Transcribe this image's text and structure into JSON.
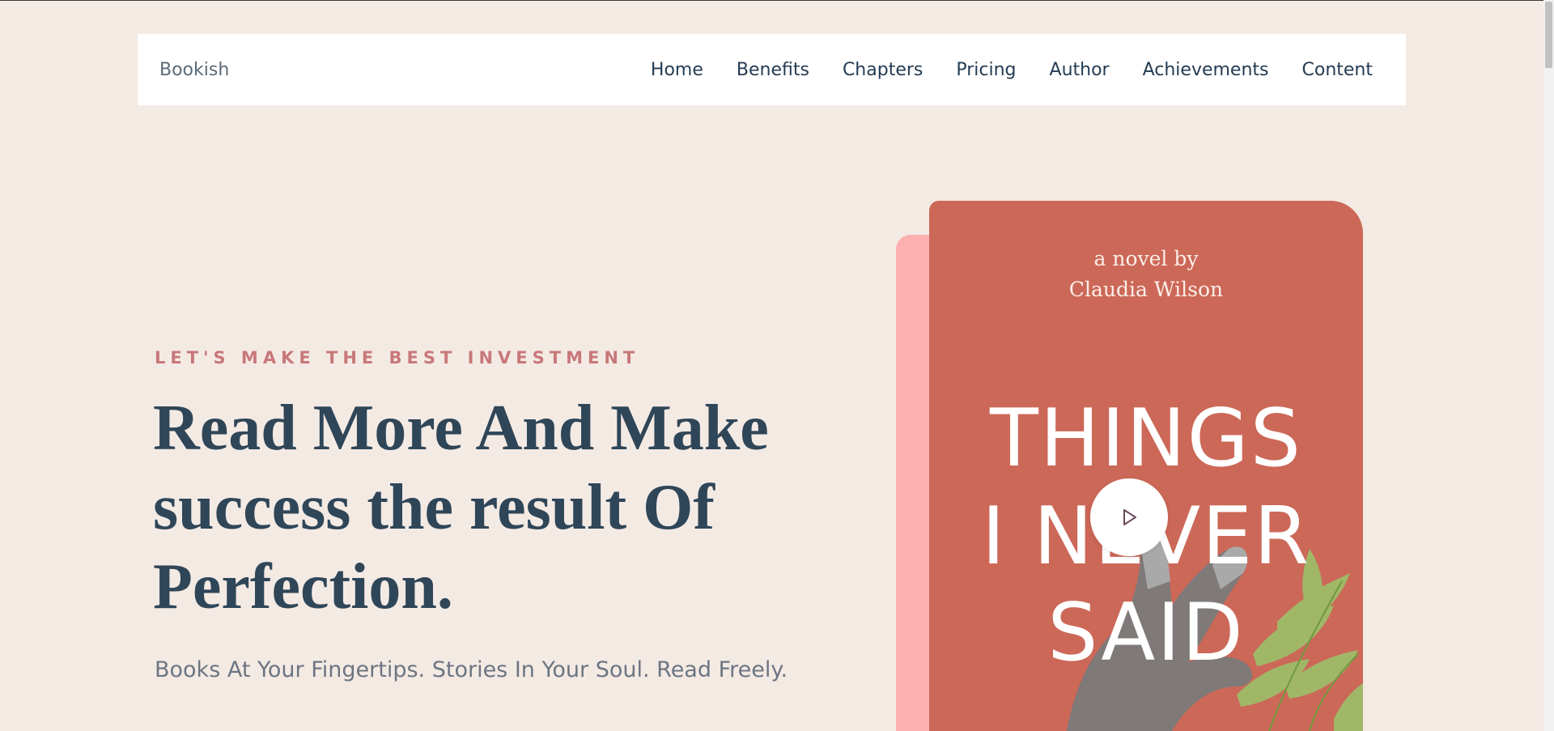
{
  "navbar": {
    "brand": "Bookish",
    "links": [
      "Home",
      "Benefits",
      "Chapters",
      "Pricing",
      "Author",
      "Achievements",
      "Content"
    ]
  },
  "hero": {
    "eyebrow": "LET'S MAKE THE BEST INVESTMENT",
    "headline_lines": [
      "Read More And Make",
      "success the result Of",
      "Perfection."
    ],
    "tagline": "Books At Your Fingertips. Stories In Your Soul. Read Freely."
  },
  "book": {
    "byline_1": "a novel by",
    "byline_2": "Claudia Wilson",
    "title_lines": [
      "THINGS",
      "I NEVER",
      "SAID"
    ]
  },
  "icons": {
    "play": "play-icon"
  },
  "colors": {
    "background": "#f4eae4",
    "accent": "#c8787a",
    "heading": "#2f4658",
    "book_cover": "#cc6858",
    "book_spine": "#fcb0b0"
  }
}
